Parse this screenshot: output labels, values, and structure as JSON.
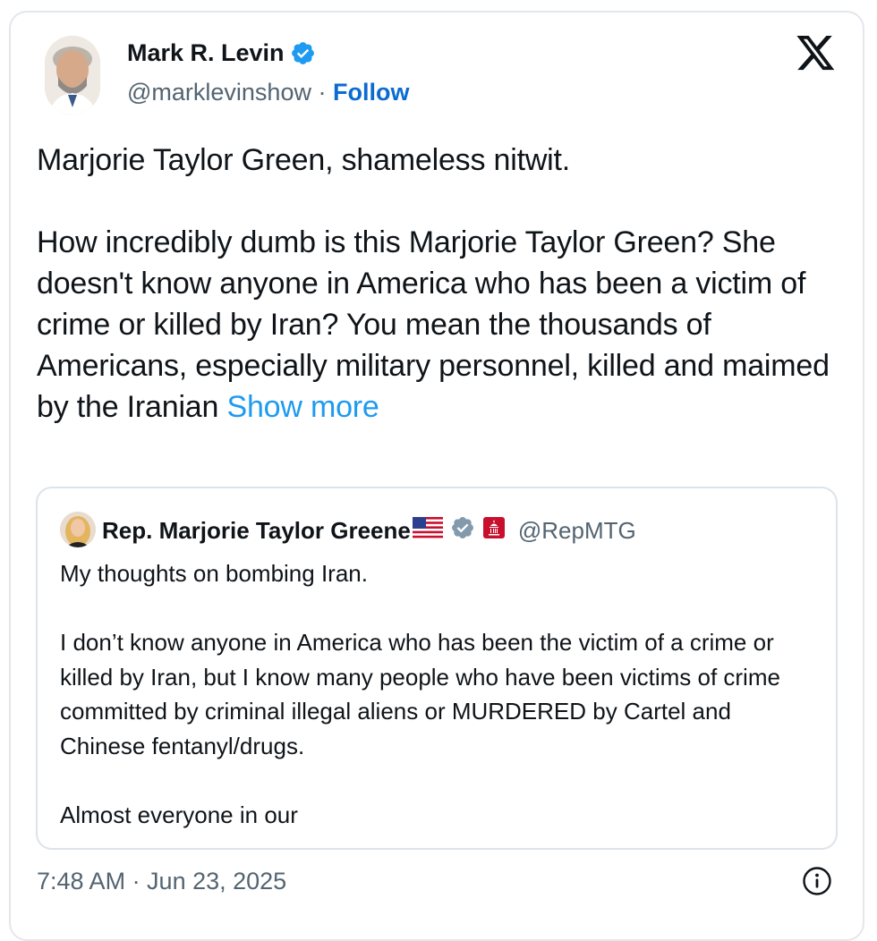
{
  "author": {
    "name": "Mark R. Levin",
    "handle": "@marklevinshow",
    "separator": "·",
    "follow_label": "Follow"
  },
  "tweet": {
    "paragraphs": [
      "Marjorie Taylor Green, shameless nitwit.",
      "How incredibly dumb is this Marjorie Taylor Green? She doesn't know anyone in America who has been a victim of crime or killed by Iran?  You mean the thousands of Americans, especially military personnel, killed and maimed by the Iranian"
    ],
    "show_more": "Show more"
  },
  "quoted": {
    "name": "Rep. Marjorie Taylor Greene",
    "handle": "@RepMTG",
    "paragraphs": [
      "My thoughts on bombing Iran.",
      "I don’t know anyone in America who has been the victim of a crime or killed by Iran, but I know many people who have been victims of crime committed by criminal illegal aliens or MURDERED by Cartel and Chinese fentanyl/drugs.",
      "Almost everyone in our"
    ]
  },
  "timestamp": "7:48 AM · Jun 23, 2025",
  "icons": {
    "verified": "verified-badge-icon",
    "flag": "us-flag-icon",
    "government": "capitol-badge-icon",
    "x_logo": "x-logo-icon",
    "info": "info-icon"
  },
  "colors": {
    "link": "#0c6bd1",
    "show_more": "#1d9bf0",
    "verified_blue": "#1d9bf0",
    "verified_gray": "#829aab",
    "text": "#0f1419",
    "secondary": "#536471"
  }
}
